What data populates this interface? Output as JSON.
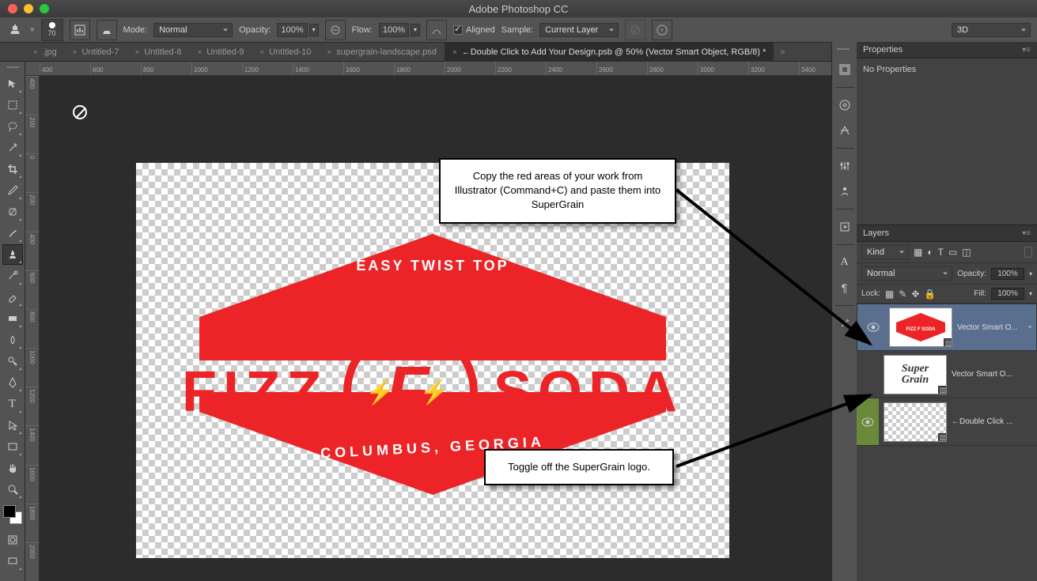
{
  "app_title": "Adobe Photoshop CC",
  "options_bar": {
    "brush_size": "70",
    "mode_label": "Mode:",
    "mode_value": "Normal",
    "opacity_label": "Opacity:",
    "opacity_value": "100%",
    "flow_label": "Flow:",
    "flow_value": "100%",
    "aligned_label": "Aligned",
    "sample_label": "Sample:",
    "sample_value": "Current Layer",
    "workspace": "3D"
  },
  "tabs": [
    {
      "label": ".jpg",
      "active": false
    },
    {
      "label": "Untitled-7",
      "active": false
    },
    {
      "label": "Untitled-8",
      "active": false
    },
    {
      "label": "Untitled-9",
      "active": false
    },
    {
      "label": "Untitled-10",
      "active": false
    },
    {
      "label": "supergrain-landscape.psd",
      "active": false
    },
    {
      "label": "←Double Click to Add Your Design.psb @ 50% (Vector Smart Object, RGB/8) *",
      "active": true
    }
  ],
  "ruler_h": [
    "400",
    "600",
    "800",
    "1000",
    "1200",
    "1400",
    "1600",
    "1800",
    "2000",
    "2200",
    "2400",
    "2600",
    "2800",
    "3000",
    "3200",
    "3400"
  ],
  "ruler_v": [
    "400",
    "200",
    "0",
    "200",
    "400",
    "600",
    "800",
    "1000",
    "1200",
    "1400",
    "1600",
    "1800",
    "2000"
  ],
  "canvas_logo": {
    "top_text": "EASY TWIST TOP",
    "left_word": "FIZZ",
    "right_word": "SODA",
    "center_letter": "F",
    "bottom_text": "COLUMBUS, GEORGIA"
  },
  "callouts": {
    "c1": "Copy the red areas of your work from Illustrator (Command+C) and paste them into SuperGrain",
    "c2": "Toggle off the SuperGrain logo."
  },
  "panels": {
    "properties_title": "Properties",
    "no_properties": "No Properties",
    "layers_title": "Layers",
    "kind": "Kind",
    "blend_mode": "Normal",
    "opacity_label": "Opacity:",
    "opacity_val": "100%",
    "lock_label": "Lock:",
    "fill_label": "Fill:",
    "fill_val": "100%",
    "layers": [
      {
        "name": "Vector Smart O...",
        "visible": true,
        "selected": true,
        "thumb": "fizz"
      },
      {
        "name": "Vector Smart O...",
        "visible": false,
        "selected": false,
        "thumb": "super"
      },
      {
        "name": "←Double Click ...",
        "visible": true,
        "selected": false,
        "thumb": "blank"
      }
    ]
  }
}
